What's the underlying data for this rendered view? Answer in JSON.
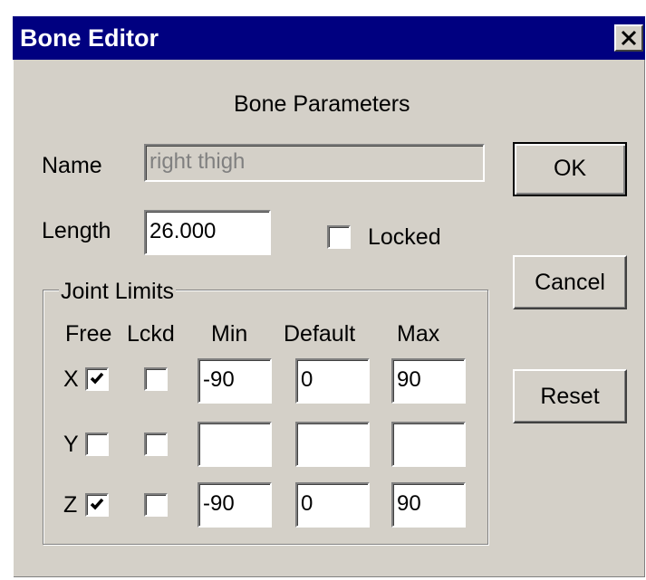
{
  "window": {
    "title": "Bone Editor",
    "close_icon": "close-x-icon"
  },
  "heading": "Bone Parameters",
  "name_field": {
    "label": "Name",
    "value": "right thigh",
    "disabled": true
  },
  "length_field": {
    "label": "Length",
    "value": "26.000"
  },
  "locked_checkbox": {
    "label": "Locked",
    "checked": false
  },
  "buttons": {
    "ok": "OK",
    "cancel": "Cancel",
    "reset": "Reset"
  },
  "joint_limits": {
    "title": "Joint Limits",
    "headers": {
      "free": "Free",
      "locked": "Lckd",
      "min": "Min",
      "default": "Default",
      "max": "Max"
    },
    "rows": [
      {
        "axis": "X",
        "free": true,
        "locked": false,
        "min": "-90",
        "default": "0",
        "max": "90"
      },
      {
        "axis": "Y",
        "free": false,
        "locked": false,
        "min": "",
        "default": "",
        "max": ""
      },
      {
        "axis": "Z",
        "free": true,
        "locked": false,
        "min": "-90",
        "default": "0",
        "max": "90"
      }
    ]
  },
  "colors": {
    "titlebar": "#000080",
    "face": "#d4d0c8"
  }
}
